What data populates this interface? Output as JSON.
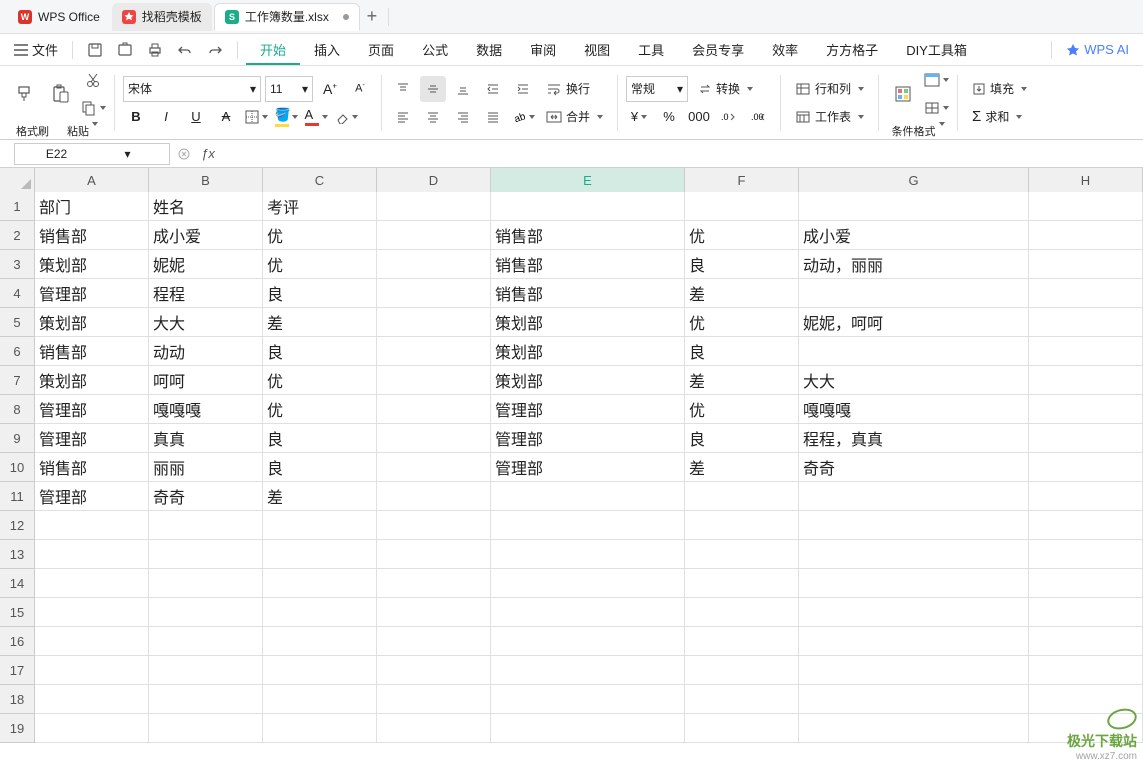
{
  "titlebar": {
    "app_name": "WPS Office",
    "tab1": "找稻壳模板",
    "tab2": "工作簿数量.xlsx",
    "add": "+"
  },
  "menu": {
    "file": "文件",
    "items": [
      "开始",
      "插入",
      "页面",
      "公式",
      "数据",
      "审阅",
      "视图",
      "工具",
      "会员专享",
      "效率",
      "方方格子",
      "DIY工具箱"
    ],
    "ai": "WPS AI"
  },
  "ribbon": {
    "format_painter": "格式刷",
    "paste": "粘贴",
    "font_name": "宋体",
    "font_size": "11",
    "wrap": "换行",
    "merge": "合并",
    "number_format": "常规",
    "convert": "转换",
    "rowcol": "行和列",
    "worksheet": "工作表",
    "cond_format": "条件格式",
    "fill": "填充",
    "sum": "求和"
  },
  "name_box": "E22",
  "col_widths": {
    "A": 114,
    "B": 114,
    "C": 114,
    "D": 114,
    "E": 194,
    "F": 114,
    "G": 230,
    "H": 114
  },
  "columns": [
    "A",
    "B",
    "C",
    "D",
    "E",
    "F",
    "G",
    "H"
  ],
  "row_count": 19,
  "selected_col": "E",
  "selection": {
    "col": "E",
    "row": 22
  },
  "cells": {
    "A1": "部门",
    "B1": "姓名",
    "C1": "考评",
    "A2": "销售部",
    "B2": "成小爱",
    "C2": "优",
    "E2": "销售部",
    "F2": "优",
    "G2": "成小爱",
    "A3": "策划部",
    "B3": "妮妮",
    "C3": "优",
    "E3": "销售部",
    "F3": "良",
    "G3": "动动，丽丽",
    "A4": "管理部",
    "B4": "程程",
    "C4": "良",
    "E4": "销售部",
    "F4": "差",
    "A5": "策划部",
    "B5": "大大",
    "C5": "差",
    "E5": "策划部",
    "F5": "优",
    "G5": "妮妮，呵呵",
    "A6": "销售部",
    "B6": "动动",
    "C6": "良",
    "E6": "策划部",
    "F6": "良",
    "A7": "策划部",
    "B7": "呵呵",
    "C7": "优",
    "E7": "策划部",
    "F7": "差",
    "G7": "大大",
    "A8": "管理部",
    "B8": "嘎嘎嘎",
    "C8": "优",
    "E8": "管理部",
    "F8": "优",
    "G8": "嘎嘎嘎",
    "A9": "管理部",
    "B9": "真真",
    "C9": "良",
    "E9": "管理部",
    "F9": "良",
    "G9": "程程，真真",
    "A10": "销售部",
    "B10": "丽丽",
    "C10": "良",
    "E10": "管理部",
    "F10": "差",
    "G10": "奇奇",
    "A11": "管理部",
    "B11": "奇奇",
    "C11": "差"
  },
  "watermark": {
    "cn": "极光下载站",
    "url": "www.xz7.com"
  }
}
